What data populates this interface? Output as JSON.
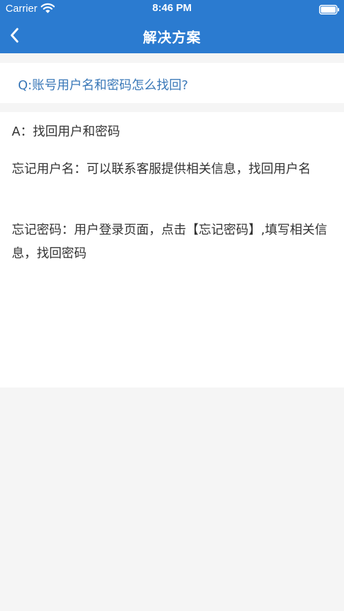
{
  "status_bar": {
    "carrier": "Carrier",
    "time": "8:46 PM",
    "wifi_icon": "wifi-icon",
    "battery_icon": "battery-icon"
  },
  "nav": {
    "title": "解决方案",
    "back_icon": "chevron-left-icon"
  },
  "question": {
    "text": "Q:账号用户名和密码怎么找回?"
  },
  "answer": {
    "paragraphs": [
      "A：找回用户和密码",
      "忘记用户名：可以联系客服提供相关信息，找回用户名",
      "忘记密码：用户登录页面，点击【忘记密码】,填写相关信息，找回密码"
    ]
  },
  "colors": {
    "header": "#2b7bd0",
    "question_text": "#3a78b8",
    "body_text": "#333333",
    "background": "#f5f5f5"
  }
}
